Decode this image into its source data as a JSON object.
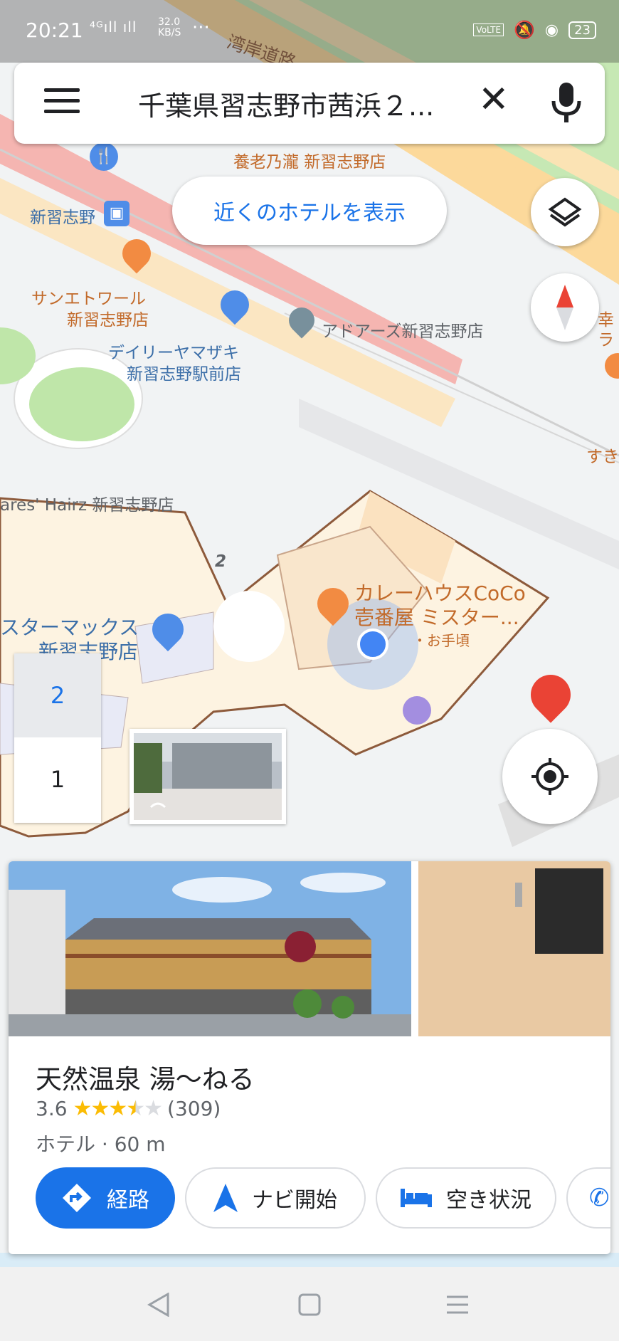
{
  "status_bar": {
    "time": "20:21",
    "network": "⁴ᴳıll ıll",
    "speed_value": "32.0",
    "speed_unit": "KB/S",
    "overflow": "···",
    "volte": "VoLTE",
    "battery": "23"
  },
  "search": {
    "query": "千葉県習志野市茜浜２...",
    "menu_icon": "hamburger-menu-icon",
    "close_icon": "close-icon",
    "mic_icon": "microphone-icon"
  },
  "hotels_button": {
    "label": "近くのホテルを表示"
  },
  "map": {
    "floor_number_marker": "2",
    "labels": [
      {
        "id": "road",
        "text": "湾岸道路"
      },
      {
        "id": "yoronotaki",
        "text": "養老乃瀧 新習志野店"
      },
      {
        "id": "station",
        "text": "新習志野"
      },
      {
        "id": "suntetoire1",
        "text": "サンエトワール"
      },
      {
        "id": "suntetoire2",
        "text": "新習志野店"
      },
      {
        "id": "adoares",
        "text": "アドアーズ新習志野店"
      },
      {
        "id": "daily1",
        "text": "デイリーヤマザキ"
      },
      {
        "id": "daily2",
        "text": "新習志野駅前店"
      },
      {
        "id": "hairz",
        "text": "ares' Hairz 新習志野店"
      },
      {
        "id": "curry1",
        "text": "カレーハウスCoCo"
      },
      {
        "id": "curry2",
        "text": "壱番屋 ミスター..."
      },
      {
        "id": "curry3",
        "text": "・お手頃"
      },
      {
        "id": "starmax1",
        "text": "スターマックス"
      },
      {
        "id": "starmax2",
        "text": "新習志野店"
      },
      {
        "id": "edge1",
        "text": "幸"
      },
      {
        "id": "edge2",
        "text": "ラ"
      },
      {
        "id": "edge3",
        "text": "すき"
      }
    ]
  },
  "floor_selector": {
    "floors": [
      "2",
      "1"
    ],
    "selected": "2"
  },
  "place": {
    "name": "天然温泉 湯〜ねる",
    "rating": "3.6",
    "stars_value": 3.6,
    "reviews": "(309)",
    "meta": "ホテル · 60 m",
    "actions": [
      {
        "label": "経路",
        "icon": "directions-icon"
      },
      {
        "label": "ナビ開始",
        "icon": "navigation-icon"
      },
      {
        "label": "空き状況",
        "icon": "bed-icon"
      }
    ]
  },
  "colors": {
    "accent": "#1a73e8",
    "pin": "#ea4335",
    "poi_orange": "#f28b42",
    "poi_blue": "#4f8de8",
    "rail": "#f3a6a3",
    "road_yellow": "#fbd38d",
    "park_green": "#b7e3a8"
  }
}
